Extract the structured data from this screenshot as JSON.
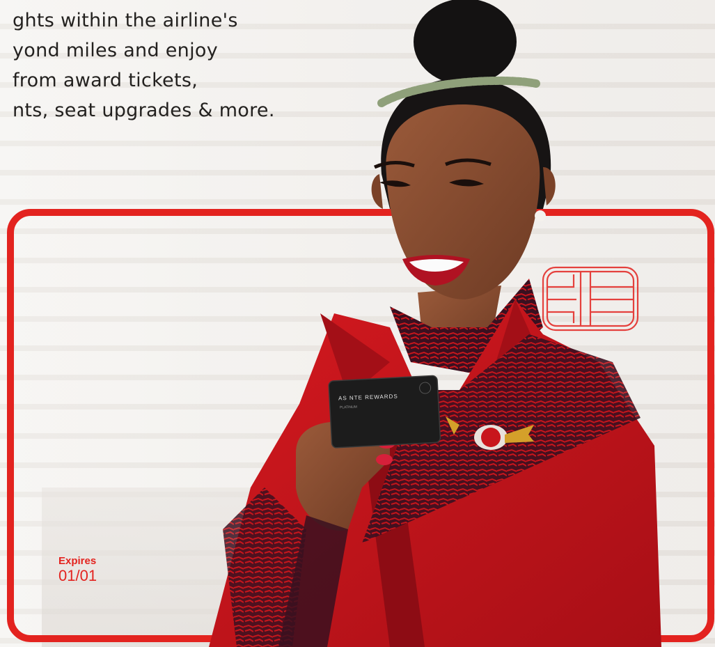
{
  "intro_lines": [
    "ghts within the airline's",
    "yond miles and enjoy",
    "from award tickets,",
    "nts, seat upgrades & more."
  ],
  "card": {
    "expires_label": "Expires",
    "expires_value": "01/01",
    "mini_card_name": "AS  NTE REWARDS",
    "mini_card_tier": "PLATINUM"
  },
  "colors": {
    "brand_red": "#e3231f",
    "uniform_red": "#c8161c",
    "text_dark": "#23211f"
  }
}
